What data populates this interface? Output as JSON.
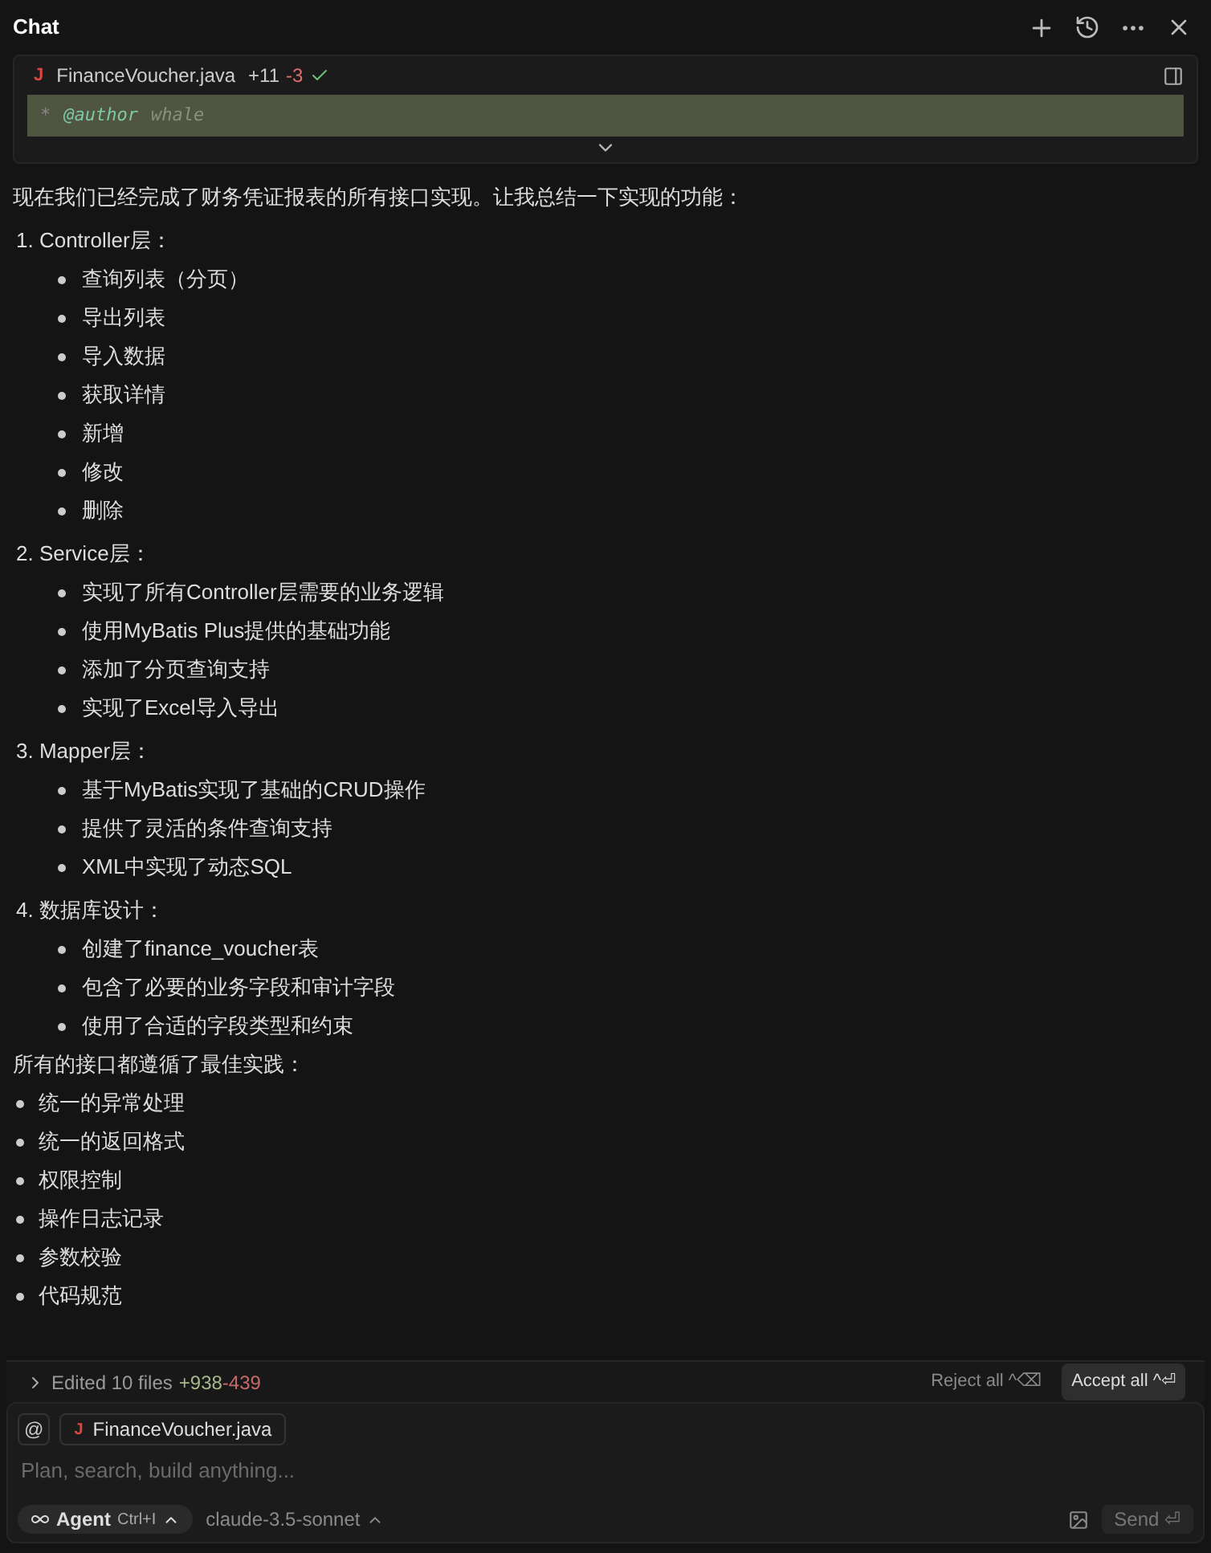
{
  "header": {
    "title": "Chat"
  },
  "file_card": {
    "icon": "J",
    "filename": "FinanceVoucher.java",
    "added": "+11",
    "removed": "-3",
    "accepted": true,
    "code": {
      "marker": "*",
      "tag": "@author",
      "value": "whale"
    }
  },
  "message": {
    "intro": "现在我们已经完成了财务凭证报表的所有接口实现。让我总结一下实现的功能：",
    "sections": [
      {
        "title": "1. Controller层：",
        "items": [
          "查询列表（分页）",
          "导出列表",
          "导入数据",
          "获取详情",
          "新增",
          "修改",
          "删除"
        ]
      },
      {
        "title": "2. Service层：",
        "items": [
          "实现了所有Controller层需要的业务逻辑",
          "使用MyBatis Plus提供的基础功能",
          "添加了分页查询支持",
          "实现了Excel导入导出"
        ]
      },
      {
        "title": "3. Mapper层：",
        "items": [
          "基于MyBatis实现了基础的CRUD操作",
          "提供了灵活的条件查询支持",
          "XML中实现了动态SQL"
        ]
      },
      {
        "title": "4. 数据库设计：",
        "items": [
          "创建了finance_voucher表",
          "包含了必要的业务字段和审计字段",
          "使用了合适的字段类型和约束"
        ]
      }
    ],
    "practices_title": "所有的接口都遵循了最佳实践：",
    "practices": [
      "统一的异常处理",
      "统一的返回格式",
      "权限控制",
      "操作日志记录",
      "参数校验",
      "代码规范"
    ]
  },
  "edits_bar": {
    "label": "Edited 10 files",
    "added": "+938",
    "removed": "-439",
    "reject": "Reject all ^⌫",
    "accept": "Accept all ^⏎"
  },
  "composer": {
    "at": "@",
    "context_icon": "J",
    "context_file": "FinanceVoucher.java",
    "placeholder": "Plan, search, build anything...",
    "mode": "Agent",
    "mode_shortcut": "Ctrl+I",
    "model": "claude-3.5-sonnet",
    "send": "Send ⏎"
  }
}
